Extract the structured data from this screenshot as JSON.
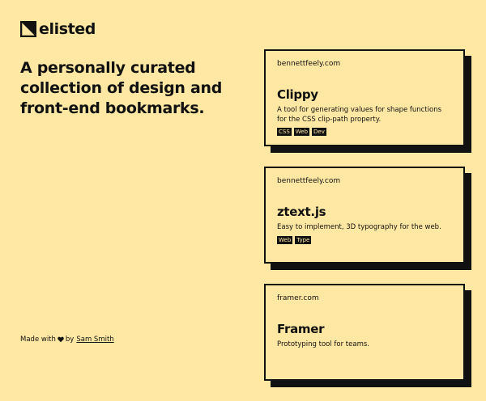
{
  "brand": {
    "name": "elisted"
  },
  "headline": "A personally curated collection of design and front-end bookmarks.",
  "footer": {
    "made_with": "Made with",
    "by": "by",
    "author": "Sam Smith"
  },
  "cards": [
    {
      "domain": "bennettfeely.com",
      "title": "Clippy",
      "description": "A tool for generating values for shape functions for the CSS clip-path property.",
      "tags": [
        "CSS",
        "Web",
        "Dev"
      ]
    },
    {
      "domain": "bennettfeely.com",
      "title": "ztext.js",
      "description": "Easy to implement, 3D typography for the web.",
      "tags": [
        "Web",
        "Type"
      ]
    },
    {
      "domain": "framer.com",
      "title": "Framer",
      "description": "Prototyping tool for teams.",
      "tags": []
    }
  ],
  "colors": {
    "background": "#ffe8a3",
    "ink": "#111111"
  }
}
